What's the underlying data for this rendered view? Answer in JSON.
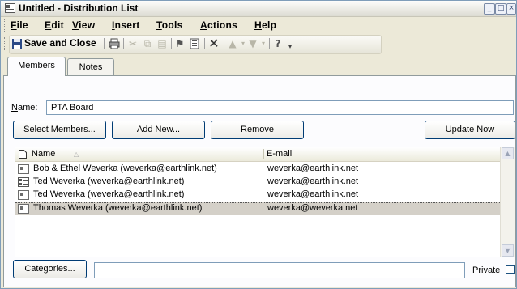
{
  "window": {
    "title": "Untitled - Distribution List"
  },
  "menu": [
    "File",
    "Edit",
    "View",
    "Insert",
    "Tools",
    "Actions",
    "Help"
  ],
  "toolbar": {
    "save_close_label": "Save and Close"
  },
  "tabs": [
    "Members",
    "Notes"
  ],
  "form": {
    "name_label": "Name:",
    "name_value": "PTA Board"
  },
  "buttons": {
    "select_members": "Select Members...",
    "add_new": "Add New...",
    "remove": "Remove",
    "update_now": "Update Now"
  },
  "list": {
    "columns": [
      "Name",
      "E-mail"
    ],
    "rows": [
      {
        "name": "Bob & Ethel Weverka (weverka@earthlink.net)",
        "email": "weverka@earthlink.net",
        "icon": "contact-icon",
        "selected": false
      },
      {
        "name": "Ted Weverka (weverka@earthlink.net)",
        "email": "weverka@earthlink.net",
        "icon": "distribution-list-icon",
        "selected": false
      },
      {
        "name": "Ted Weverka (weverka@earthlink.net)",
        "email": "weverka@earthlink.net",
        "icon": "contact-icon",
        "selected": false
      },
      {
        "name": "Thomas Weverka (weverka@earthlink.net)",
        "email": "weverka@weverka.net",
        "icon": "contact-icon",
        "selected": true
      }
    ]
  },
  "footer": {
    "categories_button": "Categories...",
    "categories_value": "",
    "private_label": "Private",
    "private_checked": false
  }
}
